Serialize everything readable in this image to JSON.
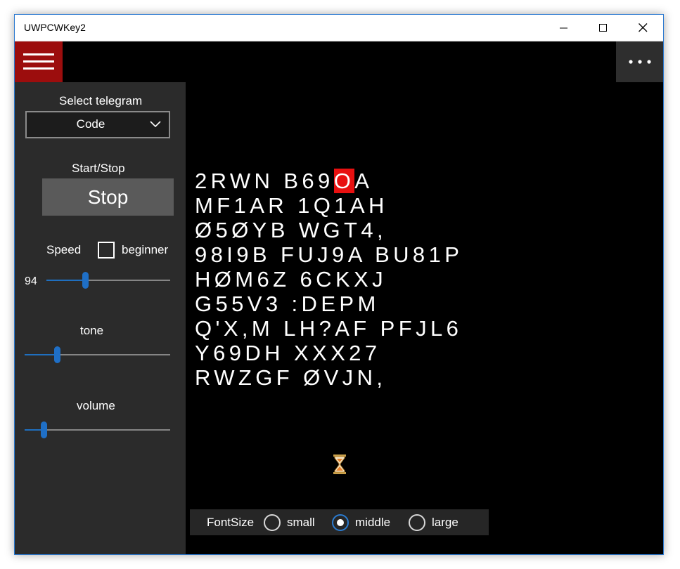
{
  "window": {
    "title": "UWPCWKey2"
  },
  "icons": {
    "menu": "hamburger-menu-icon",
    "more": "more-ellipsis-icon",
    "minimize": "minimize-icon",
    "maximize": "maximize-icon",
    "close": "close-icon",
    "dropdown": "chevron-down-icon",
    "busy": "hourglass-icon"
  },
  "colors": {
    "hamburger_bg": "#9c0d0d",
    "pane_bg": "#2b2b2b",
    "accent": "#1f6fc6",
    "highlight": "#e81010"
  },
  "pane": {
    "select_telegram_label": "Select telegram",
    "telegram_combo": {
      "selected": "Code"
    },
    "start_stop_label": "Start/Stop",
    "start_stop_button": "Stop",
    "speed_label": "Speed",
    "beginner_label": "beginner",
    "beginner_checked": false,
    "speed_value": "94",
    "speed_fraction": 0.31,
    "tone_label": "tone",
    "tone_fraction": 0.22,
    "volume_label": "volume",
    "volume_fraction": 0.13
  },
  "code_lines": [
    {
      "before": "2RWN B69",
      "highlight": "O",
      "after": "A"
    },
    {
      "before": "MF1AR 1Q1AH",
      "highlight": "",
      "after": ""
    },
    {
      "before": "Ø5ØYB WGT4,",
      "highlight": "",
      "after": ""
    },
    {
      "before": "98I9B FUJ9A BU81P",
      "highlight": "",
      "after": ""
    },
    {
      "before": "HØM6Z 6CKXJ",
      "highlight": "",
      "after": ""
    },
    {
      "before": "G55V3 :DEPM",
      "highlight": "",
      "after": ""
    },
    {
      "before": "Q'X,M LH?AF PFJL6",
      "highlight": "",
      "after": ""
    },
    {
      "before": "Y69DH XXX27",
      "highlight": "",
      "after": ""
    },
    {
      "before": "RWZGF ØVJN,",
      "highlight": "",
      "after": ""
    }
  ],
  "fontsize_bar": {
    "label": "FontSize",
    "options": [
      "small",
      "middle",
      "large"
    ],
    "selected": "middle"
  }
}
